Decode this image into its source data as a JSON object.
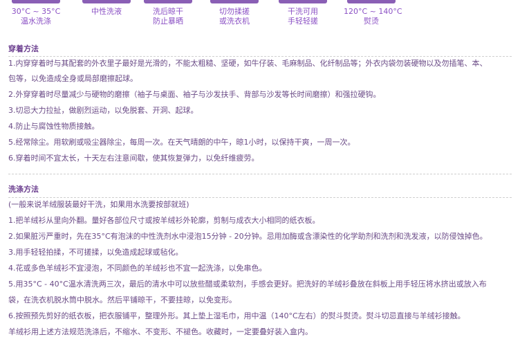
{
  "care_icons": [
    {
      "line1": "30°C ~ 35°C",
      "line2": "温水洗涤"
    },
    {
      "line1": "中性洗液",
      "line2": ""
    },
    {
      "line1": "洗后晾干",
      "line2": "防止暴晒"
    },
    {
      "line1": "切勿揉搓",
      "line2": "或洗衣机"
    },
    {
      "line1": "干洗可用",
      "line2": "手轻轻搓"
    },
    {
      "line1": "120°C ~ 140°C",
      "line2": "熨烫"
    }
  ],
  "wear": {
    "title": "穿着方法",
    "lines": [
      "1.内穿穿着时与其配套的外衣里子最好是光滑的，不能太粗糙、坚硬，如牛仔装、毛麻制品、化纤制品等；外衣内袋勿装硬物以及勿插笔、本、",
      "包等，以免造成全身或局部磨擦起球。",
      "2.外穿穿着时尽量减少与硬物的磨擦（袖子与桌面、袖子与沙发扶手、背部与沙发等长时间磨擦）和强拉硬钩。",
      "3.切忌大力拉扯，做剧烈运动，以免脱套、开洞、起球。",
      "4.防止与腐蚀性物质接触。",
      "5.经常除尘。用软刷或吸尘器除尘，每周一次。在天气晴朗的中午，晾1小时，以保持干爽，一周一次。",
      "6.穿着时间不宜太长，十天左右注意间歇，使其恢复弹力，以免纤维疲劳。"
    ]
  },
  "wash": {
    "title": "洗涤方法",
    "lines": [
      "(一般来说羊绒服装最好干洗，如果用水洗要按部就班)",
      "1.把羊绒衫从里向外翻。量好各部位尺寸或按羊绒衫外轮廓，剪制与成衣大小相同的纸衣板。",
      "2.如果脏污严重时，先在35°C有泡沫的中性洗剂水中浸泡15分钟 - 20分钟。忌用加酶或含漂染性的化学助剂和洗剂和洗发液，以防侵蚀掉色。",
      "3.用手轻轻拍揉，不可搓揉，以免造成起球或毡化。",
      "4.花或多色羊绒衫不宜浸泡，不同颜色的羊绒衫也不宜一起洗涤，以免串色。",
      "5.用35°C - 40°C温水清洗两三次，最后的清水中可以放些醋或柔软剂，手感会更好。把洗好的羊绒衫叠放在斜板上用手轻压将水挤出或放入布",
      "袋，在洗衣机脱水筒中脱水。然后平铺晾干，不要挂晾，以免变形。",
      "6.按照预先剪好的纸衣板，把衣服铺平，整理外形。其上垫上湿毛巾，用中温（140°C左右）的熨斗熨烫。熨斗切忌直接与羊绒衫接触。",
      "羊绒衫用上述方法规范洗涤后，不缩水、不变形、不褪色。收藏时，一定要叠好装入盒内。"
    ]
  }
}
